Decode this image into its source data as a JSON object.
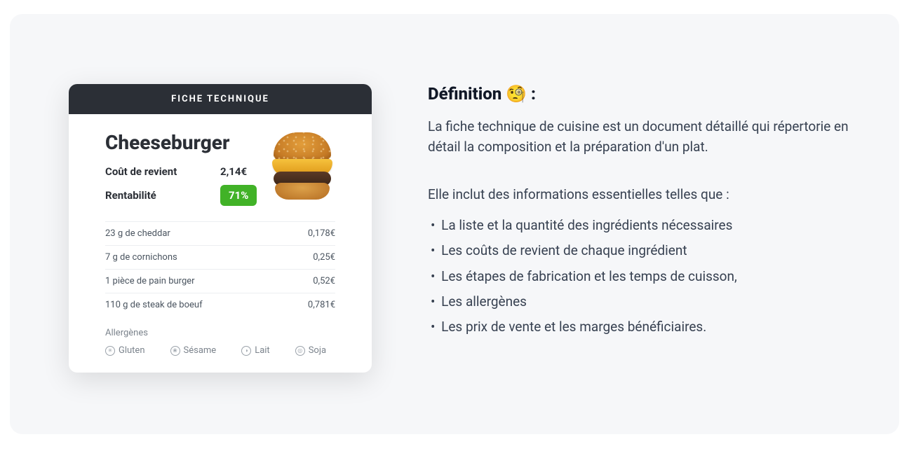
{
  "card": {
    "header": "FICHE TECHNIQUE",
    "title": "Cheeseburger",
    "cost_label": "Coût de revient",
    "cost_value": "2,14€",
    "profit_label": "Rentabilité",
    "profit_value": "71%",
    "ingredients": [
      {
        "name": "23 g de cheddar",
        "price": "0,178€"
      },
      {
        "name": "7 g de cornichons",
        "price": "0,25€"
      },
      {
        "name": "1 pièce de pain burger",
        "price": "0,52€"
      },
      {
        "name": "110 g de steak de boeuf",
        "price": "0,781€"
      }
    ],
    "allergens_title": "Allergènes",
    "allergens": [
      {
        "icon": "✳",
        "label": "Gluten"
      },
      {
        "icon": "❀",
        "label": "Sésame"
      },
      {
        "icon": "◑",
        "label": "Lait"
      },
      {
        "icon": "◎",
        "label": "Soja"
      }
    ]
  },
  "right": {
    "definition_title": "Définition 🧐 :",
    "paragraph": "La fiche technique de cuisine est un document détaillé qui répertorie en détail la composition et la préparation d'un plat.",
    "list_intro": "Elle inclut des informations essentielles telles que :",
    "items": [
      "La liste et la quantité des ingrédients nécessaires",
      "Les coûts de revient de chaque ingrédient",
      "Les étapes de fabrication et les temps de cuisson,",
      "Les allergènes",
      "Les prix de vente et les marges bénéficiaires."
    ]
  }
}
